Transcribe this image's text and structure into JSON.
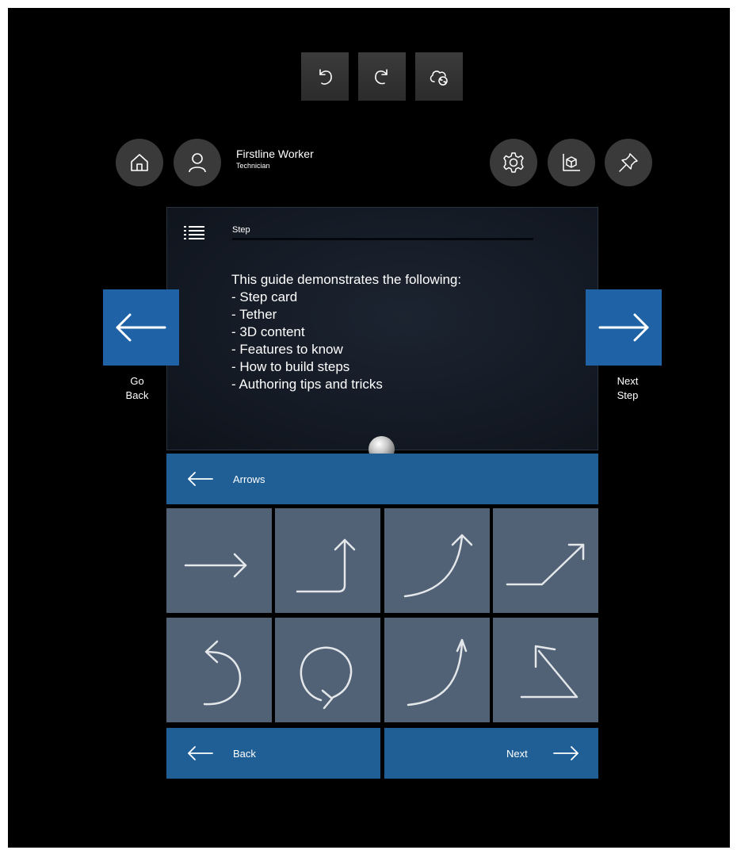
{
  "toolbar": {
    "icons": [
      "undo-icon",
      "redo-icon",
      "cloud-sync-icon"
    ]
  },
  "user": {
    "name": "Firstline Worker",
    "role": "Technician"
  },
  "step_card": {
    "label": "Step",
    "lines": [
      "This guide demonstrates the following:",
      "- Step card",
      "- Tether",
      "- 3D content",
      "- Features to know",
      "- How to build steps",
      "- Authoring tips and tricks"
    ]
  },
  "nav": {
    "go_back_line1": "Go",
    "go_back_line2": "Back",
    "next_step_line1": "Next",
    "next_step_line2": "Step"
  },
  "arrows_panel": {
    "title": "Arrows",
    "tiles": [
      "straight-arrow-icon",
      "elbow-up-arrow-icon",
      "curved-up-arrow-icon",
      "angled-up-arrow-icon",
      "u-turn-arrow-icon",
      "rotate-arrow-icon",
      "curved-up-thin-arrow-icon",
      "angled-back-arrow-icon"
    ],
    "back_label": "Back",
    "next_label": "Next"
  },
  "colors": {
    "background": "#000000",
    "accent_blue": "#1f63a6",
    "panel_blue": "#1f5f96",
    "tile": "#516176"
  }
}
